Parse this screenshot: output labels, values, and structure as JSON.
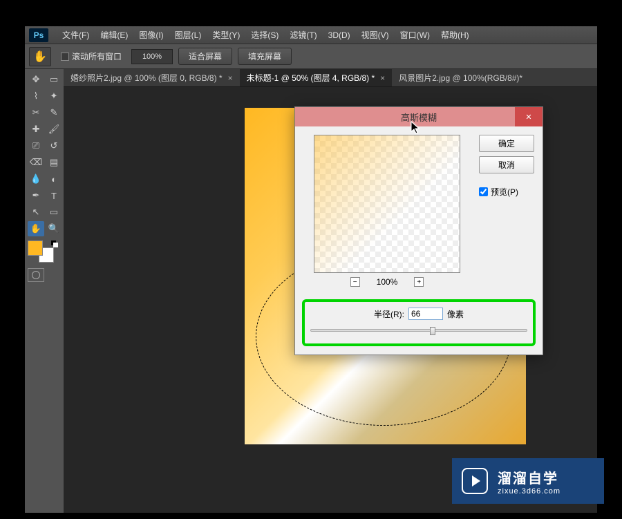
{
  "logo": "Ps",
  "menu": [
    "文件(F)",
    "编辑(E)",
    "图像(I)",
    "图层(L)",
    "类型(Y)",
    "选择(S)",
    "滤镜(T)",
    "3D(D)",
    "视图(V)",
    "窗口(W)",
    "帮助(H)"
  ],
  "options": {
    "scroll_all": "滚动所有窗口",
    "zoom": "100%",
    "fit_screen": "适合屏幕",
    "fill_screen": "填充屏幕"
  },
  "tabs": [
    {
      "label": "婚纱照片2.jpg @ 100% (图层 0, RGB/8) *"
    },
    {
      "label": "未标题-1 @ 50% (图层 4, RGB/8) *"
    },
    {
      "label": "风景图片2.jpg @ 100%(RGB/8#)*"
    }
  ],
  "dialog": {
    "title": "高斯模糊",
    "ok": "确定",
    "cancel": "取消",
    "preview": "预览(P)",
    "zoom": "100%",
    "radius_label": "半径(R):",
    "radius_value": "66",
    "radius_unit": "像素"
  },
  "watermark": {
    "big": "溜溜自学",
    "small": "zixue.3d66.com"
  }
}
